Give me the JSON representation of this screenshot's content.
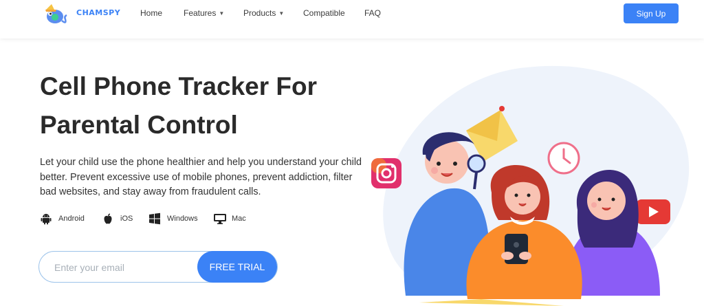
{
  "header": {
    "brand": "CHAMSPY",
    "nav": [
      {
        "label": "Home",
        "dropdown": false
      },
      {
        "label": "Features",
        "dropdown": true
      },
      {
        "label": "Products",
        "dropdown": true
      },
      {
        "label": "Compatible",
        "dropdown": false
      },
      {
        "label": "FAQ",
        "dropdown": false
      }
    ],
    "signup_label": "Sign Up"
  },
  "hero": {
    "title": "Cell Phone Tracker For Parental Control",
    "description": "Let your child use the phone healthier and help you understand your child better. Prevent excessive use of mobile phones, prevent addiction, filter bad websites, and stay away from fraudulent calls.",
    "platforms": [
      {
        "icon": "android-icon",
        "label": "Android"
      },
      {
        "icon": "apple-icon",
        "label": "iOS"
      },
      {
        "icon": "windows-icon",
        "label": "Windows"
      },
      {
        "icon": "mac-icon",
        "label": "Mac"
      }
    ],
    "email_placeholder": "Enter your email",
    "trial_label": "FREE TRIAL"
  },
  "colors": {
    "accent": "#3b82f6",
    "text_dark": "#2a2a2a",
    "blob": "#eef3fb"
  }
}
